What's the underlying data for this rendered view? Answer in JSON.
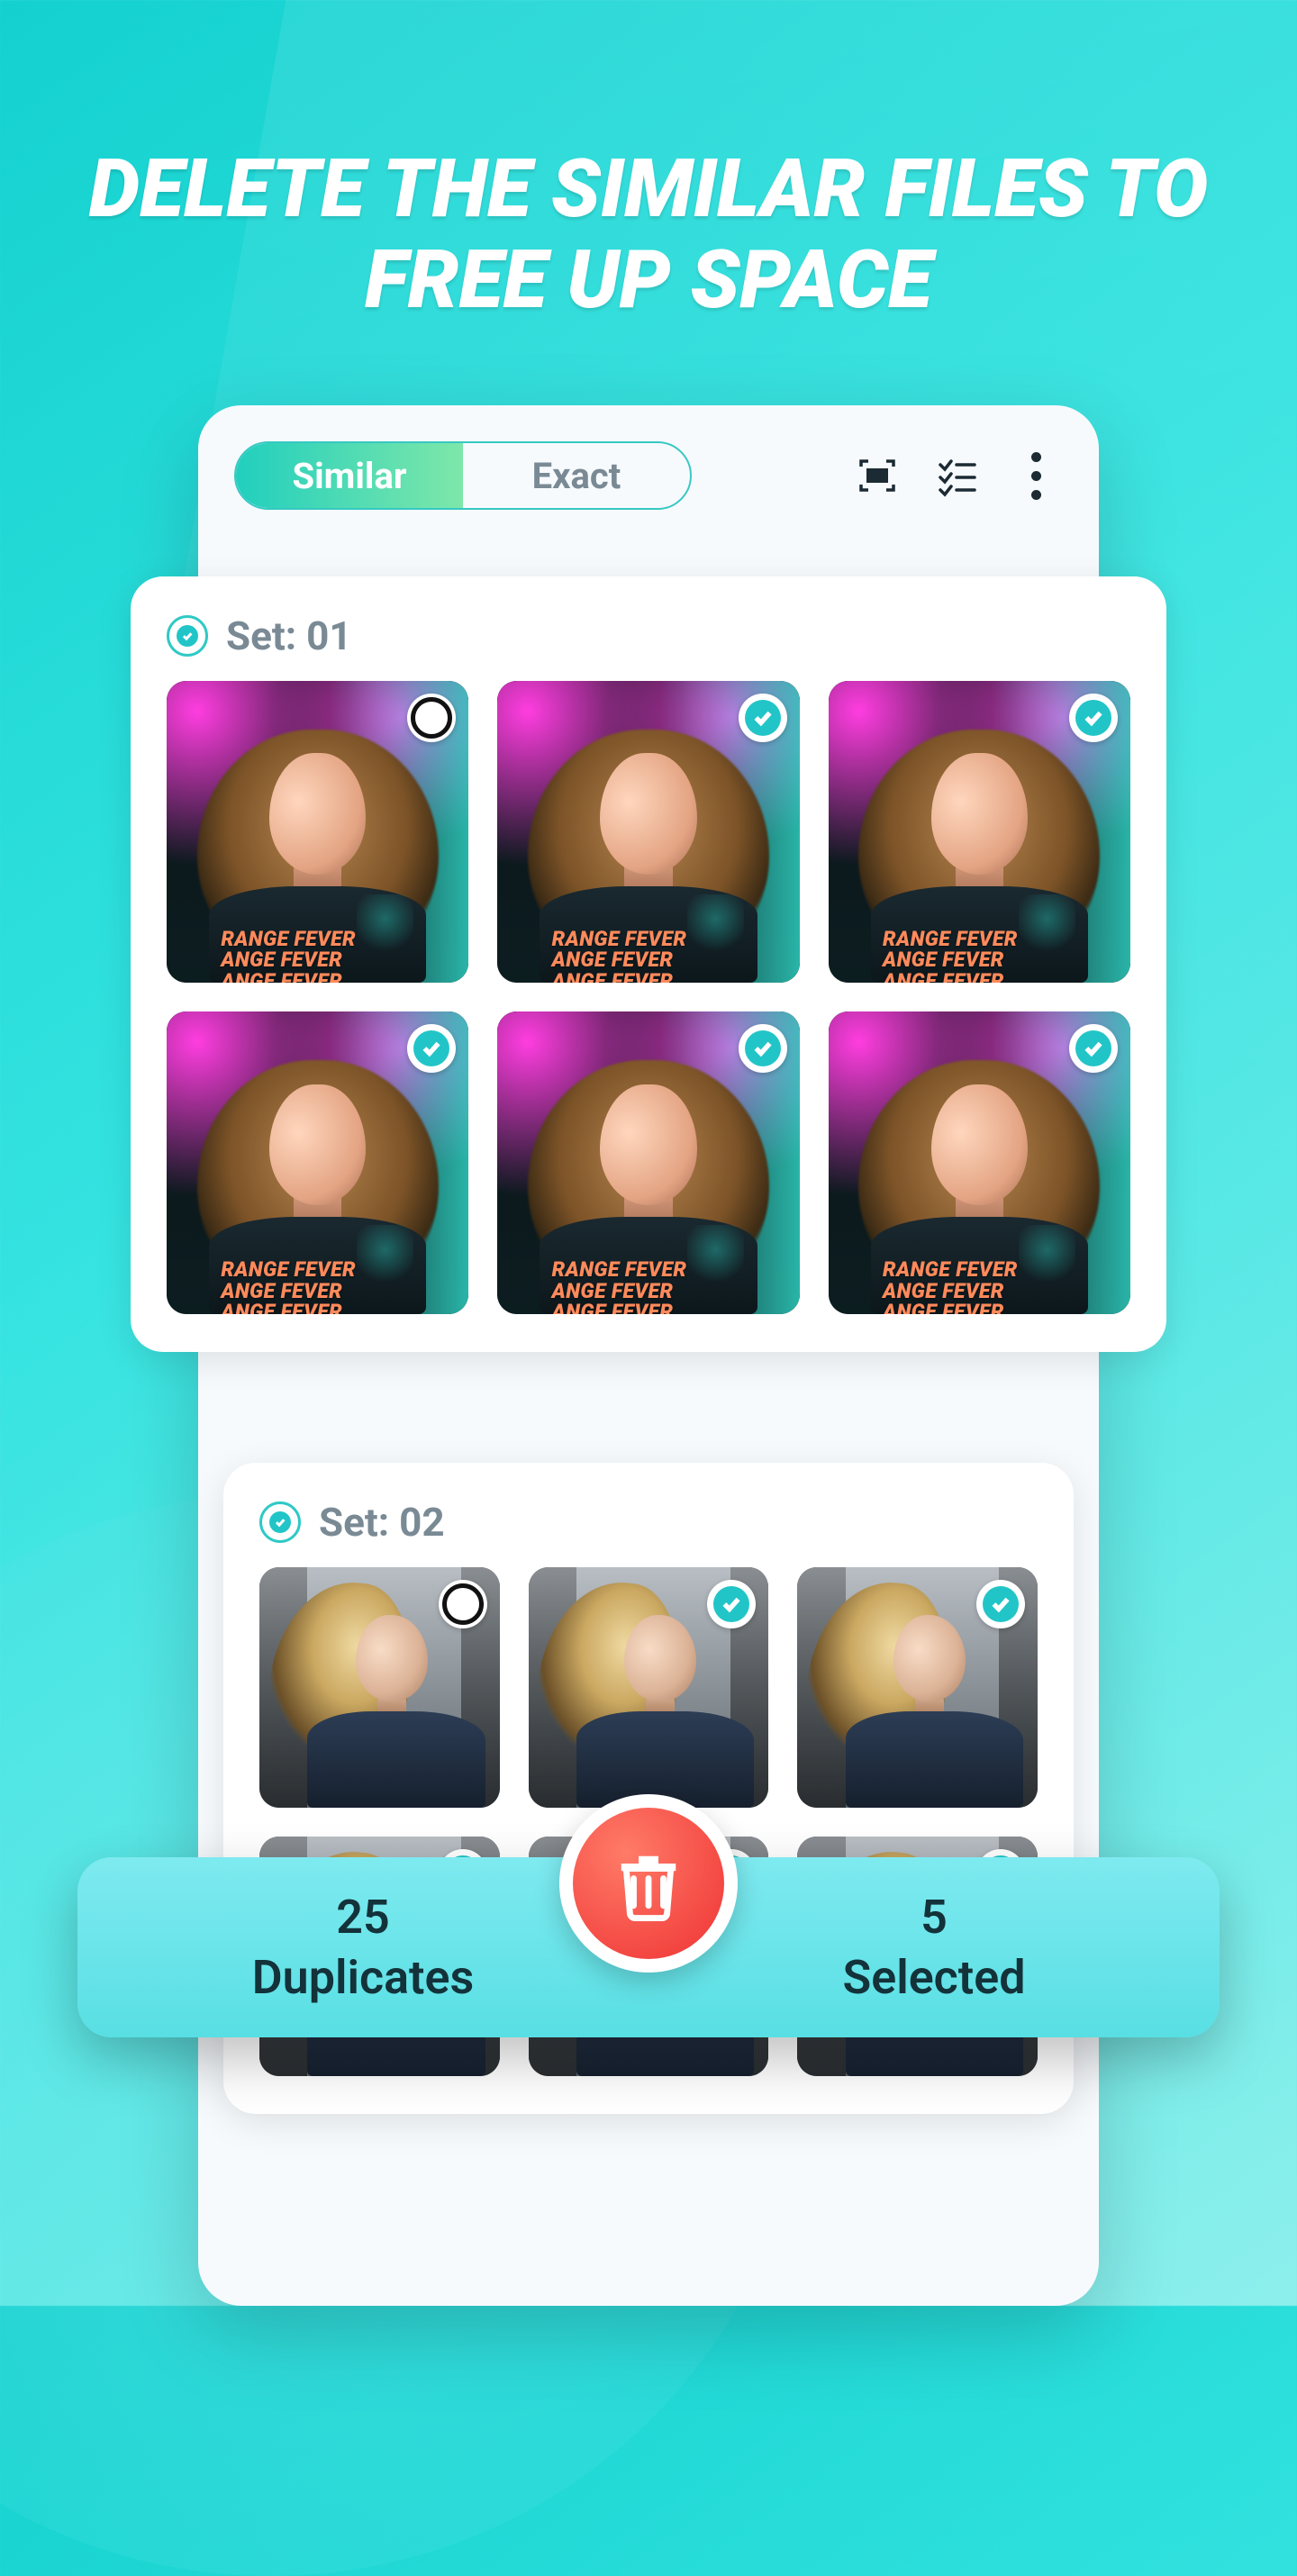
{
  "headline": "DELETE THE SIMILAR FILES TO FREE UP SPACE",
  "tabs": {
    "similar": "Similar",
    "exact": "Exact",
    "active": "similar"
  },
  "toolbar": {
    "scan_icon": "scan-icon",
    "select_all_icon": "checklist-icon",
    "more_icon": "more-vertical-icon"
  },
  "sets": [
    {
      "label": "Set: 01",
      "header_checked": true,
      "thumb_text": "RANGE FEVER\nANGE FEVER\nANGE FEVER",
      "thumbs": [
        {
          "selected": false
        },
        {
          "selected": true
        },
        {
          "selected": true
        },
        {
          "selected": true
        },
        {
          "selected": true
        },
        {
          "selected": true
        }
      ]
    },
    {
      "label": "Set: 02",
      "header_checked": true,
      "thumbs": [
        {
          "selected": false
        },
        {
          "selected": true
        },
        {
          "selected": true
        },
        {
          "selected": true
        },
        {
          "selected": true
        },
        {
          "selected": true
        }
      ]
    }
  ],
  "bottom": {
    "duplicates_count": "25",
    "duplicates_label": "Duplicates",
    "selected_count": "5",
    "selected_label": "Selected"
  },
  "colors": {
    "accent": "#22c5c7",
    "danger": "#f2413e"
  }
}
